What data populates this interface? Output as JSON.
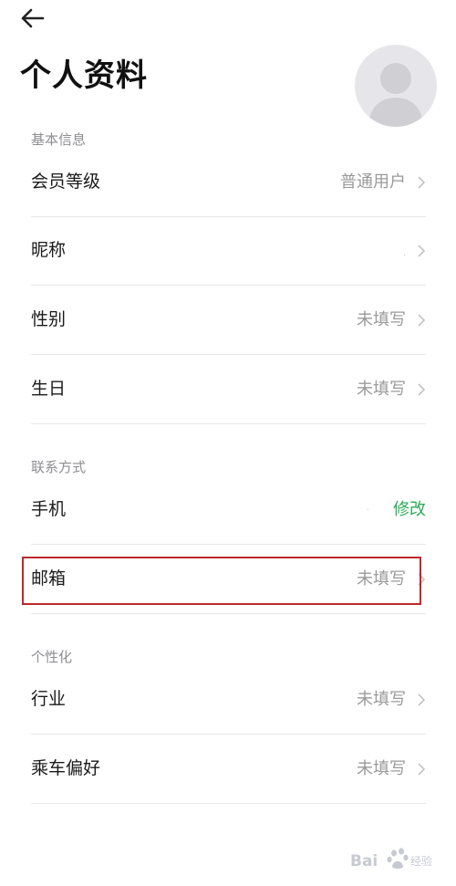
{
  "header": {
    "back_icon": "arrow-left-icon",
    "title": "个人资料",
    "avatar_icon": "user-avatar-icon"
  },
  "sections": {
    "basic": {
      "title": "基本信息",
      "member_level": {
        "label": "会员等级",
        "value": "普通用户"
      },
      "nickname": {
        "label": "昵称",
        "value": "·"
      },
      "gender": {
        "label": "性别",
        "value": "未填写"
      },
      "birthday": {
        "label": "生日",
        "value": "未填写"
      }
    },
    "contact": {
      "title": "联系方式",
      "phone": {
        "label": "手机",
        "value": "·",
        "action": "修改"
      },
      "email": {
        "label": "邮箱",
        "value": "未填写"
      }
    },
    "personal": {
      "title": "个性化",
      "industry": {
        "label": "行业",
        "value": "未填写"
      },
      "ride_preference": {
        "label": "乘车偏好",
        "value": "未填写"
      }
    }
  },
  "colors": {
    "accent_green": "#2bab58",
    "highlight_red": "#c0272d",
    "secondary_text": "#9a9a9a"
  },
  "watermark": {
    "text": "Bai 经验",
    "icon": "baidu-paw-logo"
  }
}
